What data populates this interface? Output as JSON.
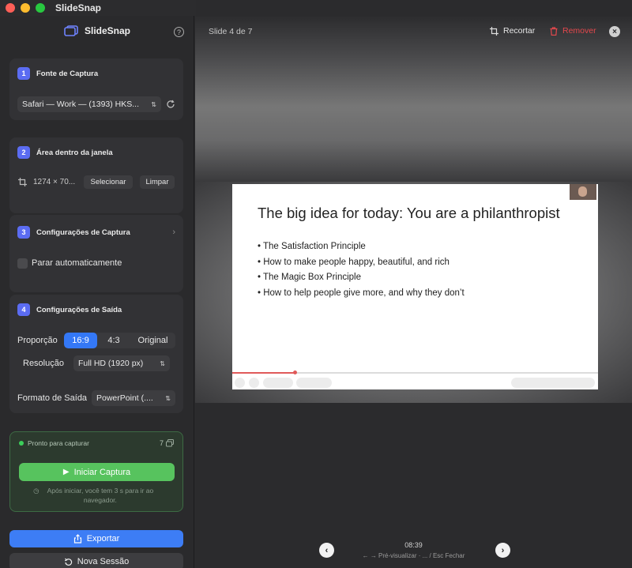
{
  "app": {
    "title": "SlideSnap",
    "brand": "SlideSnap"
  },
  "sidebar": {
    "source": {
      "step": "1",
      "title": "Fonte de Captura",
      "window_value": "Safari — Work — (1393) HKS..."
    },
    "area": {
      "step": "2",
      "title": "Área dentro da janela",
      "dimensions": "1274 × 70...",
      "select_label": "Selecionar",
      "clear_label": "Limpar"
    },
    "capture_settings": {
      "step": "3",
      "title": "Configurações de Captura",
      "auto_stop_label": "Parar automaticamente",
      "auto_stop_checked": false
    },
    "output": {
      "step": "4",
      "title": "Configurações de Saída",
      "ratio_label": "Proporção",
      "ratio_options": [
        "16:9",
        "4:3",
        "Original"
      ],
      "ratio_selected": "16:9",
      "resolution_label": "Resolução",
      "resolution_value": "Full HD (1920 px)",
      "format_label": "Formato de Saída",
      "format_value": "PowerPoint (...."
    },
    "status": {
      "text": "Pronto para capturar",
      "count": "7",
      "start_label": "Iniciar Captura",
      "hint": "Após iniciar, você tem 3 s para ir ao navegador."
    },
    "export_label": "Exportar",
    "new_session_label": "Nova Sessão"
  },
  "main": {
    "slide_counter": "Slide 4 de 7",
    "crop_label": "Recortar",
    "remove_label": "Remover",
    "slide": {
      "title": "The big idea for today: You are a philanthropist",
      "bullets": [
        "The Satisfaction Principle",
        "How to make people happy, beautiful, and rich",
        "The Magic Box Principle",
        "How to help people give more, and why they don’t"
      ],
      "video_progress": 0.17
    },
    "time": "08:39",
    "keys_hint": "← → Pré-visualizar  ·  ... / Esc Fechar"
  },
  "colors": {
    "accent": "#3478f6",
    "remove": "#e5484d",
    "ready": "#57c35e",
    "step": "#5b6cf2"
  }
}
